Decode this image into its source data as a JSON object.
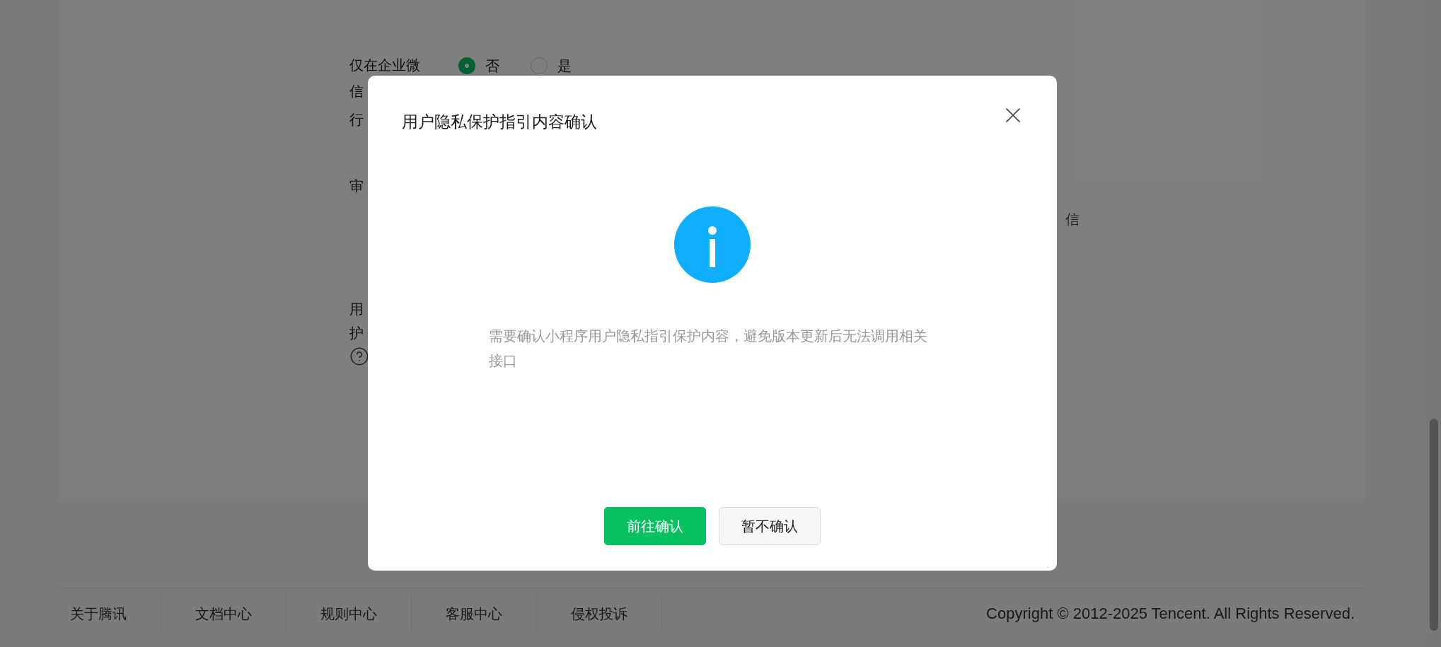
{
  "form": {
    "field_1": {
      "label_lines": [
        "仅在企业微",
        "信"
      ],
      "options": [
        {
          "label": "否",
          "selected": true
        },
        {
          "label": "是",
          "selected": false
        }
      ]
    },
    "field_2": {
      "label": "行"
    },
    "field_3": {
      "label": "审",
      "note": "信"
    },
    "field_4": {
      "label_lines": [
        "用",
        "护"
      ]
    }
  },
  "dialog": {
    "title": "用户隐私保护指引内容确认",
    "message": "需要确认小程序用户隐私指引保护内容，避免版本更新后无法调用相关接口",
    "buttons": [
      {
        "label": "前往确认",
        "kind": "primary"
      },
      {
        "label": "暂不确认",
        "kind": "secondary"
      }
    ]
  },
  "footer": {
    "links": [
      "关于腾讯",
      "文档中心",
      "规则中心",
      "客服中心",
      "侵权投诉"
    ],
    "copyright": "Copyright © 2012-2025 Tencent. All Rights Reserved."
  }
}
